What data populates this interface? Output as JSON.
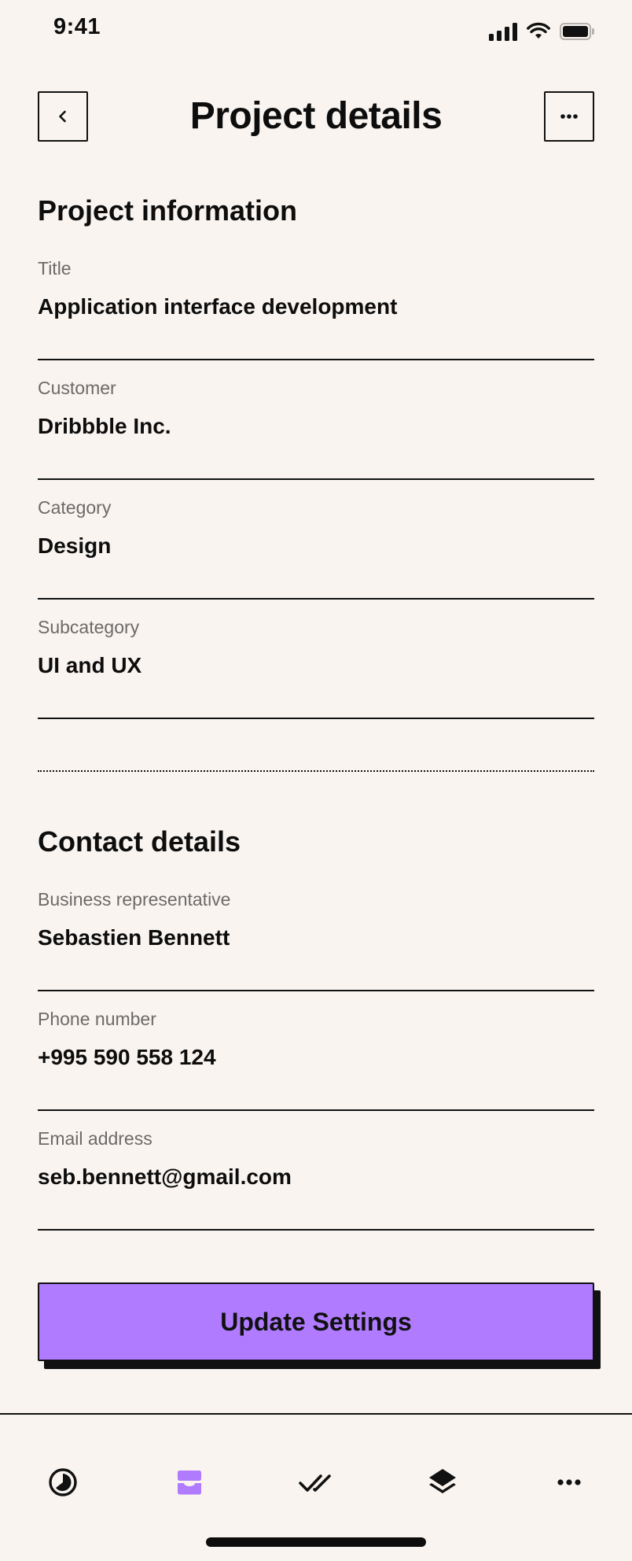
{
  "status": {
    "time": "9:41"
  },
  "header": {
    "title": "Project details"
  },
  "project_info": {
    "heading": "Project information",
    "fields": [
      {
        "label": "Title",
        "value": "Application interface development"
      },
      {
        "label": "Customer",
        "value": "Dribbble Inc."
      },
      {
        "label": "Category",
        "value": "Design"
      },
      {
        "label": "Subcategory",
        "value": "UI and UX"
      }
    ]
  },
  "contact": {
    "heading": "Contact details",
    "fields": [
      {
        "label": "Business representative",
        "value": "Sebastien Bennett"
      },
      {
        "label": "Phone number",
        "value": "+995 590 558 124"
      },
      {
        "label": "Email address",
        "value": "seb.bennett@gmail.com"
      }
    ]
  },
  "actions": {
    "update_label": "Update Settings"
  },
  "tabbar": {
    "active_index": 1,
    "active_color": "#b07bff",
    "items": [
      {
        "icon": "timer-icon"
      },
      {
        "icon": "inbox-icon"
      },
      {
        "icon": "double-check-icon"
      },
      {
        "icon": "layers-icon"
      },
      {
        "icon": "more-icon"
      }
    ]
  },
  "colors": {
    "background": "#f9f4f0",
    "accent": "#b07bff",
    "ink": "#0d0d0d",
    "muted": "#6c6a69"
  }
}
